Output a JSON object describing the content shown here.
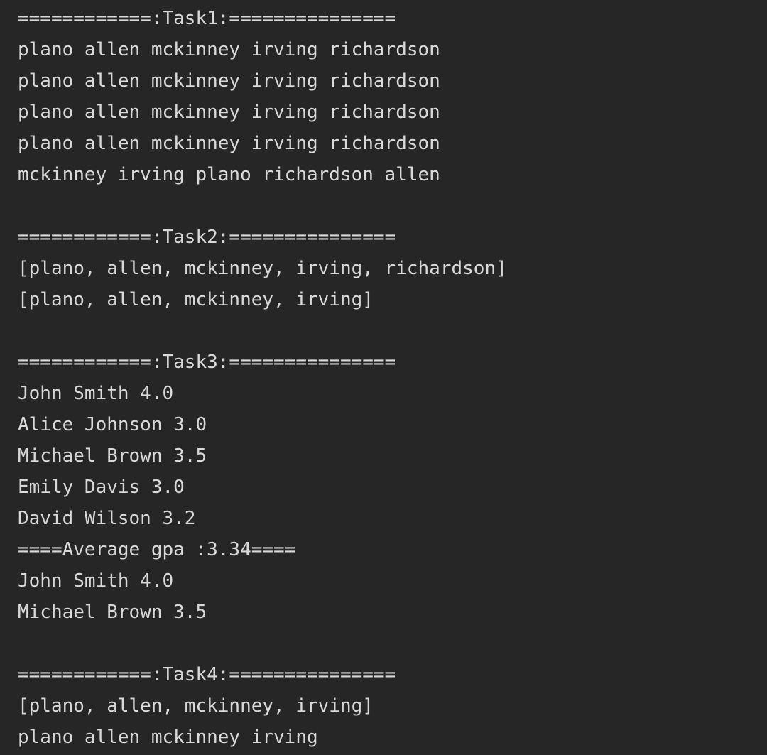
{
  "console": {
    "lines": [
      "============:Task1:===============",
      "plano allen mckinney irving richardson",
      "plano allen mckinney irving richardson",
      "plano allen mckinney irving richardson",
      "plano allen mckinney irving richardson",
      "mckinney irving plano richardson allen",
      "",
      "============:Task2:===============",
      "[plano, allen, mckinney, irving, richardson]",
      "[plano, allen, mckinney, irving]",
      "",
      "============:Task3:===============",
      "John Smith 4.0",
      "Alice Johnson 3.0",
      "Michael Brown 3.5",
      "Emily Davis 3.0",
      "David Wilson 3.2",
      "====Average gpa :3.34====",
      "John Smith 4.0",
      "Michael Brown 3.5",
      "",
      "============:Task4:===============",
      "[plano, allen, mckinney, irving]",
      "plano allen mckinney irving"
    ]
  }
}
